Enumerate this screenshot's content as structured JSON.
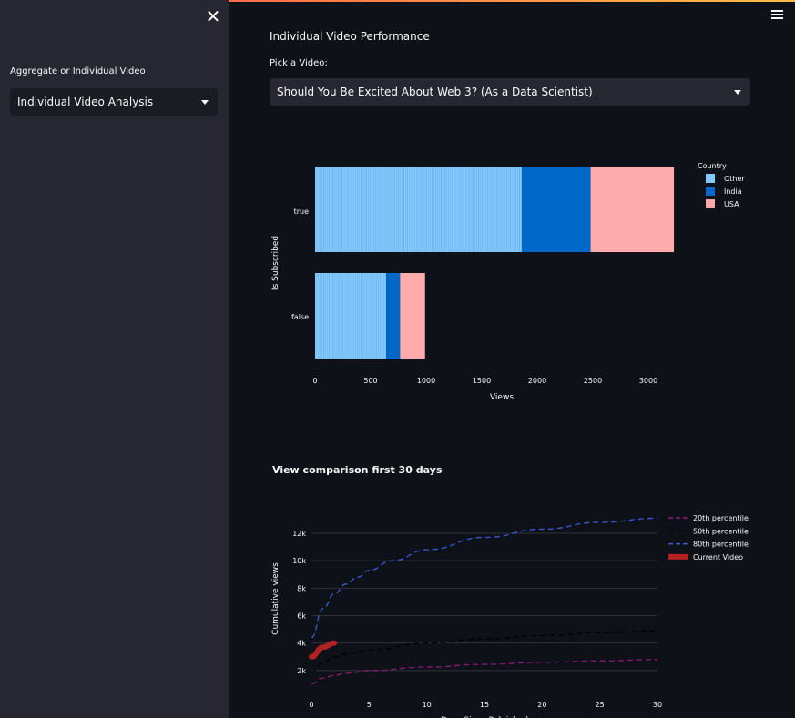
{
  "sidebar": {
    "close_icon": "close-icon",
    "select_label": "Aggregate or Individual Video",
    "select_value": "Individual Video Analysis"
  },
  "header": {
    "menu_icon": "hamburger-menu-icon"
  },
  "main": {
    "title": "Individual Video Performance",
    "pick_label": "Pick a Video:",
    "video_value": "Should You Be Excited About Web 3? (As a Data Scientist)"
  },
  "chart_data": [
    {
      "type": "bar",
      "orientation": "horizontal",
      "stacked": true,
      "title": "",
      "xlabel": "Views",
      "ylabel": "Is Subscribed",
      "categories": [
        "true",
        "false"
      ],
      "xlim": [
        0,
        3300
      ],
      "xticks": [
        0,
        500,
        1000,
        1500,
        2000,
        2500,
        3000
      ],
      "legend_title": "Country",
      "legend_position": "top-right",
      "series": [
        {
          "name": "Other",
          "color": "#83c9ff",
          "values": [
            1860,
            640
          ]
        },
        {
          "name": "India",
          "color": "#0068c9",
          "values": [
            620,
            125
          ]
        },
        {
          "name": "USA",
          "color": "#ffabab",
          "values": [
            750,
            225
          ]
        }
      ]
    },
    {
      "type": "line",
      "title": "View comparison first 30 days",
      "xlabel": "Days Since Published",
      "ylabel": "Cumulative views",
      "xlim": [
        0,
        30
      ],
      "ylim": [
        0,
        13500
      ],
      "xticks": [
        0,
        5,
        10,
        15,
        20,
        25,
        30
      ],
      "yticks": [
        2000,
        4000,
        6000,
        8000,
        10000,
        12000
      ],
      "ytick_labels": [
        "2k",
        "4k",
        "6k",
        "8k",
        "10k",
        "12k"
      ],
      "legend_position": "top-right",
      "series": [
        {
          "name": "20th percentile",
          "color": "#8b1a7a",
          "dash": true,
          "x": [
            0,
            1,
            2,
            3,
            5,
            10,
            15,
            20,
            25,
            30
          ],
          "y": [
            1050,
            1450,
            1650,
            1800,
            2000,
            2250,
            2450,
            2600,
            2700,
            2800
          ]
        },
        {
          "name": "50th percentile",
          "color": "#000000",
          "dash": true,
          "x": [
            0,
            1,
            2,
            3,
            5,
            10,
            15,
            20,
            25,
            30
          ],
          "y": [
            1900,
            2600,
            3000,
            3200,
            3500,
            4000,
            4300,
            4550,
            4750,
            4900
          ]
        },
        {
          "name": "80th percentile",
          "color": "#3a5bd9",
          "dash": true,
          "x": [
            0,
            1,
            2,
            3,
            4,
            5,
            7,
            10,
            15,
            20,
            25,
            30
          ],
          "y": [
            4400,
            6500,
            7600,
            8300,
            8800,
            9300,
            10000,
            10800,
            11700,
            12300,
            12800,
            13100
          ]
        },
        {
          "name": "Current Video",
          "color": "#b22222",
          "dash": false,
          "x": [
            0,
            1,
            2
          ],
          "y": [
            3000,
            3700,
            4000
          ]
        }
      ]
    }
  ]
}
